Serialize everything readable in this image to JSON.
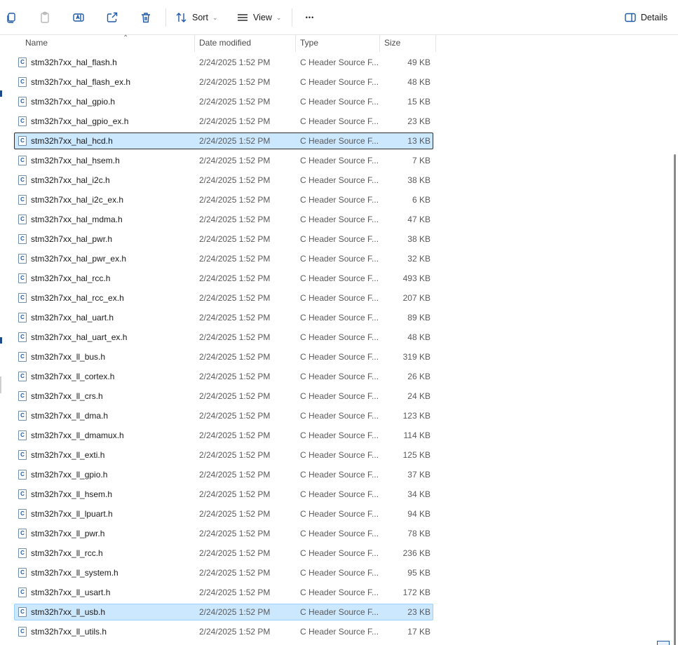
{
  "toolbar": {
    "sort_label": "Sort",
    "view_label": "View",
    "more_label": "•••",
    "details_label": "Details"
  },
  "columns": {
    "name": "Name",
    "date": "Date modified",
    "type": "Type",
    "size": "Size"
  },
  "files": [
    {
      "name": "stm32h7xx_hal_flash.h",
      "date": "2/24/2025 1:52 PM",
      "type": "C Header Source F...",
      "size": "49 KB"
    },
    {
      "name": "stm32h7xx_hal_flash_ex.h",
      "date": "2/24/2025 1:52 PM",
      "type": "C Header Source F...",
      "size": "48 KB"
    },
    {
      "name": "stm32h7xx_hal_gpio.h",
      "date": "2/24/2025 1:52 PM",
      "type": "C Header Source F...",
      "size": "15 KB"
    },
    {
      "name": "stm32h7xx_hal_gpio_ex.h",
      "date": "2/24/2025 1:52 PM",
      "type": "C Header Source F...",
      "size": "23 KB"
    },
    {
      "name": "stm32h7xx_hal_hcd.h",
      "date": "2/24/2025 1:52 PM",
      "type": "C Header Source F...",
      "size": "13 KB"
    },
    {
      "name": "stm32h7xx_hal_hsem.h",
      "date": "2/24/2025 1:52 PM",
      "type": "C Header Source F...",
      "size": "7 KB"
    },
    {
      "name": "stm32h7xx_hal_i2c.h",
      "date": "2/24/2025 1:52 PM",
      "type": "C Header Source F...",
      "size": "38 KB"
    },
    {
      "name": "stm32h7xx_hal_i2c_ex.h",
      "date": "2/24/2025 1:52 PM",
      "type": "C Header Source F...",
      "size": "6 KB"
    },
    {
      "name": "stm32h7xx_hal_mdma.h",
      "date": "2/24/2025 1:52 PM",
      "type": "C Header Source F...",
      "size": "47 KB"
    },
    {
      "name": "stm32h7xx_hal_pwr.h",
      "date": "2/24/2025 1:52 PM",
      "type": "C Header Source F...",
      "size": "38 KB"
    },
    {
      "name": "stm32h7xx_hal_pwr_ex.h",
      "date": "2/24/2025 1:52 PM",
      "type": "C Header Source F...",
      "size": "32 KB"
    },
    {
      "name": "stm32h7xx_hal_rcc.h",
      "date": "2/24/2025 1:52 PM",
      "type": "C Header Source F...",
      "size": "493 KB"
    },
    {
      "name": "stm32h7xx_hal_rcc_ex.h",
      "date": "2/24/2025 1:52 PM",
      "type": "C Header Source F...",
      "size": "207 KB"
    },
    {
      "name": "stm32h7xx_hal_uart.h",
      "date": "2/24/2025 1:52 PM",
      "type": "C Header Source F...",
      "size": "89 KB"
    },
    {
      "name": "stm32h7xx_hal_uart_ex.h",
      "date": "2/24/2025 1:52 PM",
      "type": "C Header Source F...",
      "size": "48 KB"
    },
    {
      "name": "stm32h7xx_ll_bus.h",
      "date": "2/24/2025 1:52 PM",
      "type": "C Header Source F...",
      "size": "319 KB"
    },
    {
      "name": "stm32h7xx_ll_cortex.h",
      "date": "2/24/2025 1:52 PM",
      "type": "C Header Source F...",
      "size": "26 KB"
    },
    {
      "name": "stm32h7xx_ll_crs.h",
      "date": "2/24/2025 1:52 PM",
      "type": "C Header Source F...",
      "size": "24 KB"
    },
    {
      "name": "stm32h7xx_ll_dma.h",
      "date": "2/24/2025 1:52 PM",
      "type": "C Header Source F...",
      "size": "123 KB"
    },
    {
      "name": "stm32h7xx_ll_dmamux.h",
      "date": "2/24/2025 1:52 PM",
      "type": "C Header Source F...",
      "size": "114 KB"
    },
    {
      "name": "stm32h7xx_ll_exti.h",
      "date": "2/24/2025 1:52 PM",
      "type": "C Header Source F...",
      "size": "125 KB"
    },
    {
      "name": "stm32h7xx_ll_gpio.h",
      "date": "2/24/2025 1:52 PM",
      "type": "C Header Source F...",
      "size": "37 KB"
    },
    {
      "name": "stm32h7xx_ll_hsem.h",
      "date": "2/24/2025 1:52 PM",
      "type": "C Header Source F...",
      "size": "34 KB"
    },
    {
      "name": "stm32h7xx_ll_lpuart.h",
      "date": "2/24/2025 1:52 PM",
      "type": "C Header Source F...",
      "size": "94 KB"
    },
    {
      "name": "stm32h7xx_ll_pwr.h",
      "date": "2/24/2025 1:52 PM",
      "type": "C Header Source F...",
      "size": "78 KB"
    },
    {
      "name": "stm32h7xx_ll_rcc.h",
      "date": "2/24/2025 1:52 PM",
      "type": "C Header Source F...",
      "size": "236 KB"
    },
    {
      "name": "stm32h7xx_ll_system.h",
      "date": "2/24/2025 1:52 PM",
      "type": "C Header Source F...",
      "size": "95 KB"
    },
    {
      "name": "stm32h7xx_ll_usart.h",
      "date": "2/24/2025 1:52 PM",
      "type": "C Header Source F...",
      "size": "172 KB"
    },
    {
      "name": "stm32h7xx_ll_usb.h",
      "date": "2/24/2025 1:52 PM",
      "type": "C Header Source F...",
      "size": "23 KB"
    },
    {
      "name": "stm32h7xx_ll_utils.h",
      "date": "2/24/2025 1:52 PM",
      "type": "C Header Source F...",
      "size": "17 KB"
    }
  ],
  "selected_files": [
    "stm32h7xx_hal_hcd.h",
    "stm32h7xx_ll_usb.h"
  ],
  "focused_file": "stm32h7xx_hal_hcd.h",
  "file_icon": "c-source-file-icon",
  "file_icon_letter": "C",
  "colors": {
    "selection_bg": "#cce8ff",
    "selection_border": "#99d1ff",
    "accent": "#1f5aa8"
  }
}
